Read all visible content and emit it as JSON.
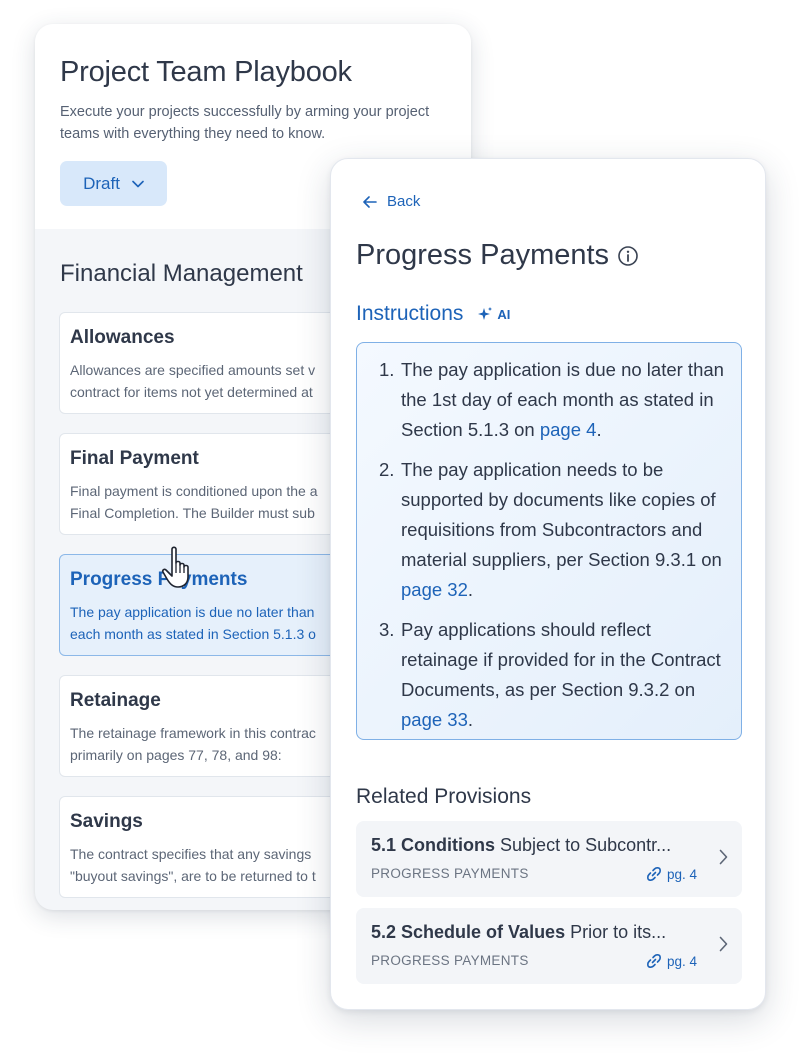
{
  "playbook": {
    "title": "Project Team Playbook",
    "description": "Execute your projects successfully by arming your project teams with everything they need to know.",
    "status_label": "Draft",
    "section_title": "Financial Management",
    "entries": [
      {
        "title": "Allowances",
        "line1": "Allowances are specified amounts set v",
        "line2": "contract for items not yet determined at"
      },
      {
        "title": "Final Payment",
        "line1": "Final payment is conditioned upon the a",
        "line2": "Final Completion. The Builder must sub"
      },
      {
        "title": "Progress Payments",
        "line1": "The pay application is due no later than",
        "line2": "each month as stated in Section 5.1.3 o"
      },
      {
        "title": "Retainage",
        "line1": "The retainage framework in this contrac",
        "line2": "primarily on pages 77, 78, and 98:"
      },
      {
        "title": "Savings",
        "line1": "The contract specifies that any savings",
        "line2": "\"buyout savings\", are to be returned to t"
      }
    ]
  },
  "detail": {
    "back_label": "Back",
    "title": "Progress Payments",
    "instructions_label": "Instructions",
    "ai_label": "AI",
    "instructions": [
      {
        "num": "1.",
        "text": "The pay application is due no later than the 1st day of each month as stated in Section 5.1.3 on ",
        "link": "page 4",
        "end": "."
      },
      {
        "num": "2.",
        "text": "The pay application needs to be supported by documents like copies of requisitions from Subcontractors and material suppliers, per Section 9.3.1 on ",
        "link": "page 32",
        "end": "."
      },
      {
        "num": "3.",
        "text": "Pay applications should reflect retainage if provided for in the Contract Documents, as per Section 9.3.2 on ",
        "link": "page 33",
        "end": "."
      }
    ],
    "related_title": "Related Provisions",
    "provisions": [
      {
        "heading": "5.1 Conditions",
        "snippet": "Subject to Subcontr...",
        "category": "PROGRESS PAYMENTS",
        "page": "pg. 4"
      },
      {
        "heading": "5.2 Schedule of Values",
        "snippet": "Prior to its...",
        "category": "PROGRESS PAYMENTS",
        "page": "pg. 4"
      }
    ]
  },
  "colors": {
    "accent": "#1d63b8",
    "accent_light": "#d8e8fa",
    "text": "#2f3849"
  }
}
